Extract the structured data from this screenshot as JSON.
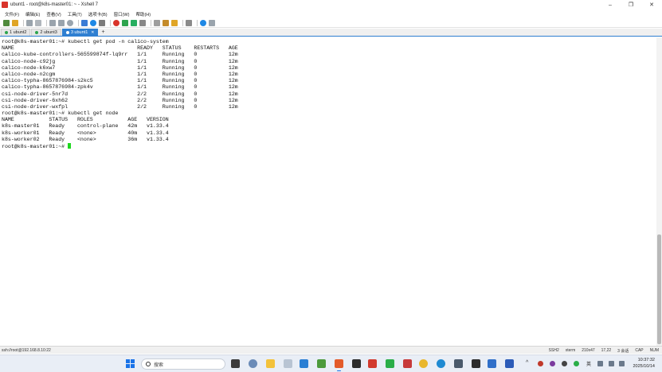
{
  "window": {
    "title": "ubunt1 - root@k8s-master01: ~ - Xshell 7",
    "controls": [
      "–",
      "❐",
      "✕"
    ]
  },
  "menu": [
    "文件(F)",
    "编辑(E)",
    "查看(V)",
    "工具(T)",
    "选项卡(B)",
    "窗口(W)",
    "帮助(H)"
  ],
  "tabs": [
    {
      "label": "1 ubunt2",
      "active": false
    },
    {
      "label": "2 ubunt3",
      "active": false
    },
    {
      "label": "3 ubunt1",
      "active": true
    }
  ],
  "tab_add": "+",
  "terminal_lines": [
    "root@k8s-master01:~# kubectl get pod -n calico-system",
    "NAME                                       READY   STATUS    RESTARTS   AGE",
    "calico-kube-controllers-565599874f-lq9rr   1/1     Running   0          12m",
    "calico-node-c92jg                          1/1     Running   0          12m",
    "calico-node-k6xw7                          1/1     Running   0          12m",
    "calico-node-n2cgm                          1/1     Running   0          12m",
    "calico-typha-8657876984-s2kc5              1/1     Running   0          12m",
    "calico-typha-8657876984-zpk4v              1/1     Running   0          12m",
    "csi-node-driver-5nr7d                      2/2     Running   0          12m",
    "csi-node-driver-6xh62                      2/2     Running   0          12m",
    "csi-node-driver-wxfpl                      2/2     Running   0          12m",
    "root@k8s-master01:~# kubectl get node",
    "NAME           STATUS   ROLES           AGE   VERSION",
    "k8s-master01   Ready    control-plane   42m   v1.33.4",
    "k8s-worker01   Ready    <none>          40m   v1.33.4",
    "k8s-worker02   Ready    <none>          36m   v1.33.4"
  ],
  "prompt": "root@k8s-master01:~# ",
  "statusbar": {
    "connection": "ssh://root@192.168.8.10:22",
    "protocol": "SSH2",
    "terminal": "xterm",
    "size": "210x47",
    "cursor_pos": "17,22",
    "sessions": "3 会话",
    "caps": "CAP",
    "num": "NUM"
  },
  "taskbar": {
    "search_placeholder": "搜索",
    "ime": "英",
    "time": "10:37:32",
    "date": "2025/10/14"
  }
}
